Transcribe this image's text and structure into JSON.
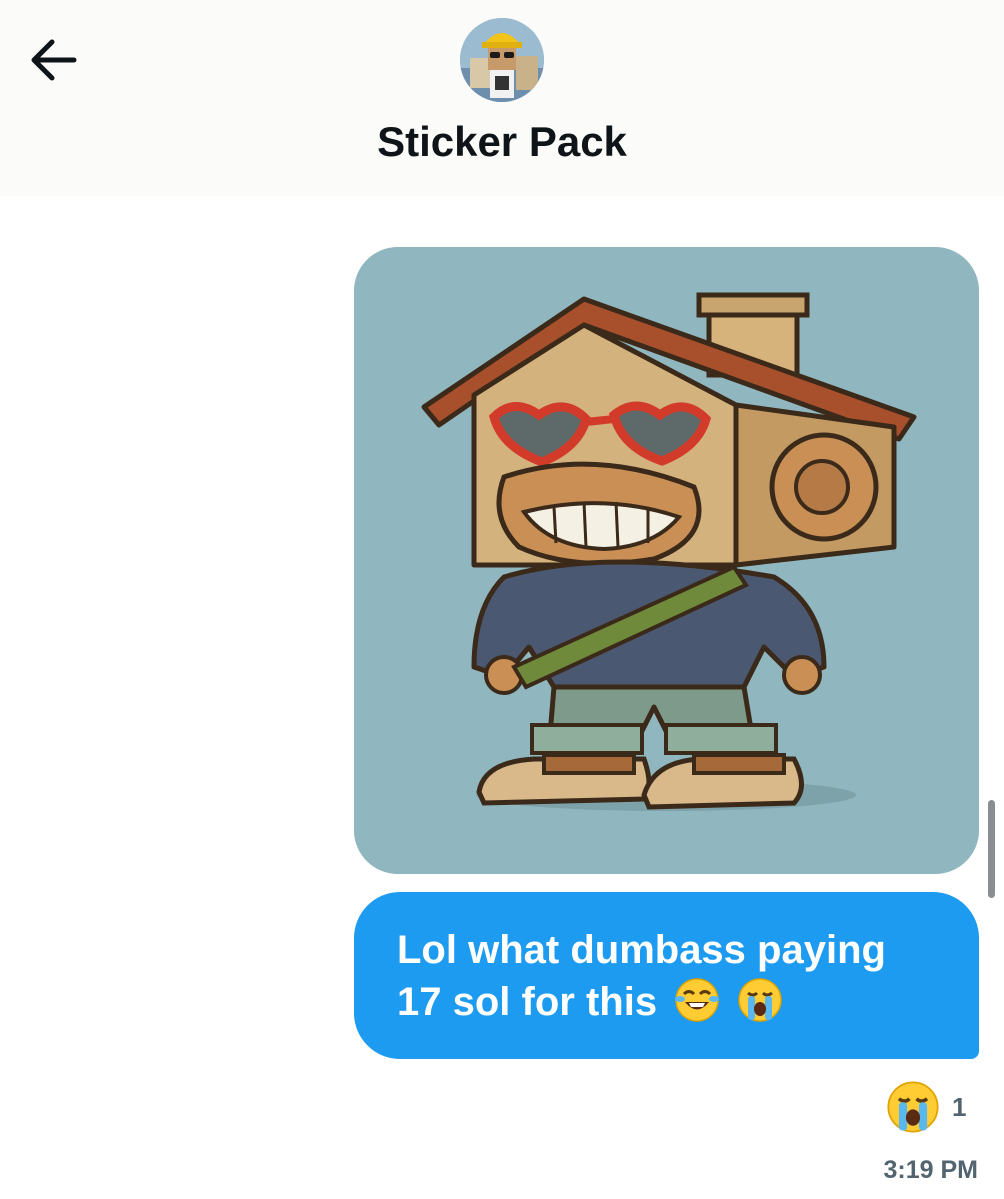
{
  "header": {
    "title": "Sticker Pack",
    "back_icon": "arrow-left-icon",
    "avatar_icon": "avatar-image"
  },
  "messages": [
    {
      "type": "image",
      "image": "cartoon-ape-with-house-head-sticker"
    },
    {
      "type": "text",
      "text_line1": "Lol what dumbass paying",
      "text_line2": "17 sol for this",
      "emojis": [
        "face-with-tears-of-joy-icon",
        "loudly-crying-face-icon"
      ]
    }
  ],
  "reaction": {
    "emoji": "loudly-crying-face-icon",
    "count": "1"
  },
  "timestamp": "3:19 PM",
  "colors": {
    "bubble": "#1d9bf0",
    "image_bg": "#90b7bf",
    "meta_text": "#536471"
  }
}
